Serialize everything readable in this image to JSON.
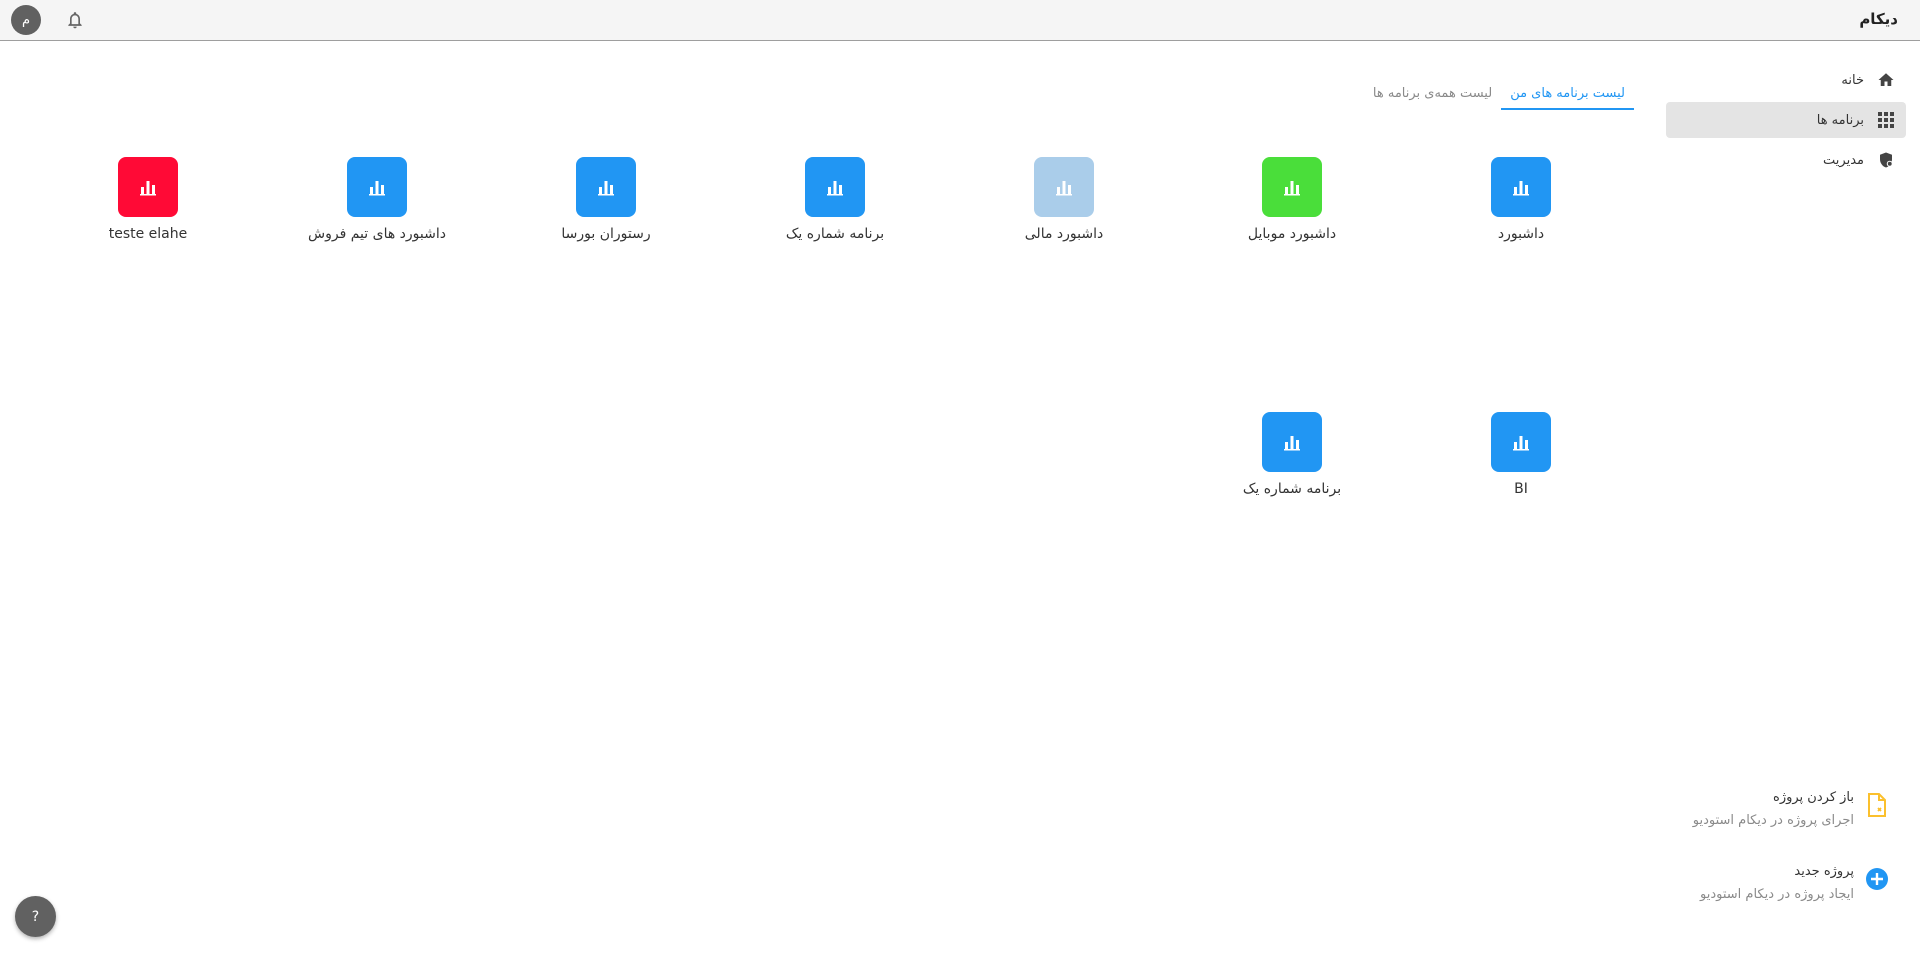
{
  "header": {
    "brand": "دیکام",
    "avatar_letter": "م"
  },
  "sidebar": {
    "items": [
      {
        "label": "خانه",
        "icon": "home-icon"
      },
      {
        "label": "برنامه ها",
        "icon": "apps-grid-icon",
        "active": true
      },
      {
        "label": "مدیریت",
        "icon": "admin-shield-icon"
      }
    ]
  },
  "tabs": [
    {
      "label": "لیست برنامه های من",
      "active": true
    },
    {
      "label": "لیست همه‌ی برنامه ها",
      "active": false
    }
  ],
  "apps": [
    {
      "label": "داشبورد",
      "color": "#2196f3",
      "icon": "bar-chart-icon"
    },
    {
      "label": "داشبورد موبایل",
      "color": "#4ade3a",
      "icon": "bar-chart-icon"
    },
    {
      "label": "داشبورد مالی",
      "color": "#aacdea",
      "icon": "bar-chart-icon"
    },
    {
      "label": "برنامه شماره یک",
      "color": "#2196f3",
      "icon": "bar-chart-icon"
    },
    {
      "label": "رستوران بورسا",
      "color": "#2196f3",
      "icon": "bar-chart-icon"
    },
    {
      "label": "داشبورد های تیم فروش",
      "color": "#2196f3",
      "icon": "bar-chart-icon"
    },
    {
      "label": "teste elahe",
      "color": "#ff0a36",
      "icon": "bar-chart-icon"
    },
    {
      "label": "BI",
      "color": "#2196f3",
      "icon": "bar-chart-icon"
    },
    {
      "label": "برنامه شماره یک",
      "color": "#2196f3",
      "icon": "bar-chart-icon"
    }
  ],
  "actions": {
    "open_project": {
      "title": "باز کردن پروژه",
      "subtitle": "اجرای پروژه در دیکام استودیو",
      "icon": "open-file-icon",
      "color": "#fbc02d"
    },
    "new_project": {
      "title": "پروژه جدید",
      "subtitle": "ایجاد پروژه در دیکام استودیو",
      "icon": "add-circle-icon",
      "color": "#2196f3"
    }
  },
  "help": {
    "label": "?"
  }
}
